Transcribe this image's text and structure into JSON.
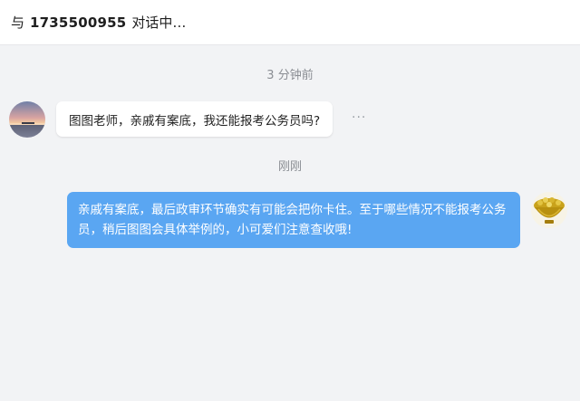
{
  "header": {
    "prefix": "与",
    "phone_number": "1735500955",
    "status": "对话中…"
  },
  "messages": [
    {
      "timestamp": "3 分钟前",
      "side": "left",
      "text": "图图老师，亲戚有案底，我还能报考公务员吗?",
      "more_label": "···"
    },
    {
      "timestamp": "刚刚",
      "side": "right",
      "text": "亲戚有案底，最后政审环节确实有可能会把你卡住。至于哪些情况不能报考公务员，稍后图图会具体举例的，小可爱们注意查收哦!"
    }
  ],
  "colors": {
    "outgoing_bubble": "#5aa6f2",
    "incoming_bubble": "#ffffff",
    "background": "#f2f3f5"
  }
}
